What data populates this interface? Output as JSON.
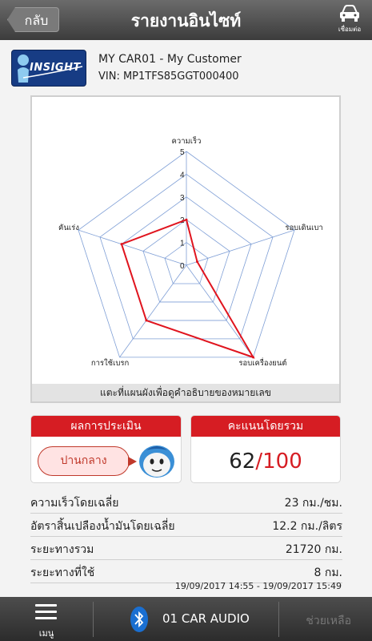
{
  "header": {
    "back_label": "กลับ",
    "title": "รายงานอินไซท์",
    "connect_label": "เชื่อมต่อ"
  },
  "logo": {
    "text": "INSIGHT"
  },
  "car": {
    "name": "MY CAR01 - My Customer",
    "vin": "VIN: MP1TFS85GGT000400"
  },
  "chart_data": {
    "type": "radar",
    "axes": [
      "ความเร็ว",
      "รอบเดินเบา",
      "รอบเครื่องยนต์",
      "การใช้เบรก",
      "คันเร่ง"
    ],
    "values": [
      2,
      0.5,
      5,
      3,
      3
    ],
    "scale_ticks": [
      "0",
      "1",
      "2",
      "3",
      "4",
      "5"
    ],
    "range": [
      0,
      5
    ],
    "colors": {
      "grid": "#7f9fd6",
      "series": "#e0141e"
    }
  },
  "chart_caption": "แตะที่แผนผังเพื่อดูคำอธิบายของหมายเลข",
  "evaluation": {
    "title": "ผลการประเมิน",
    "result": "ปานกลาง"
  },
  "total": {
    "title": "คะแนนโดยรวม",
    "score": "62",
    "max": "/100"
  },
  "stats": [
    {
      "label": "ความเร็วโดยเฉลี่ย",
      "value": "23 กม./ชม."
    },
    {
      "label": "อัตราสิ้นเปลืองน้ำมันโดยเฉลี่ย",
      "value": "12.2  กม./ลิตร"
    },
    {
      "label": "ระยะทางรวม",
      "value": "21720 กม."
    },
    {
      "label": "ระยะทางที่ใช้",
      "value": "8 กม."
    }
  ],
  "date_range": "19/09/2017 14:55 - 19/09/2017 15:49",
  "bottom": {
    "menu_label": "เมนู",
    "device": "01 CAR AUDIO",
    "help": "ช่วยเหลือ"
  },
  "icons": [
    "back-arrow-icon",
    "car-icon",
    "menu-icon",
    "bluetooth-icon",
    "mascot-icon"
  ],
  "colors": {
    "accent": "#d61d23",
    "header": "#4a4a4a",
    "score_max": "#d61d23"
  }
}
